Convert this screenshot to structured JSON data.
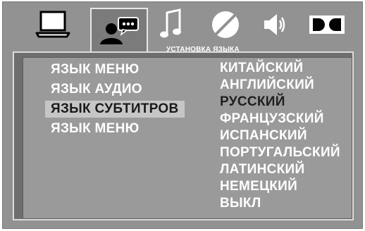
{
  "tabs": [
    {
      "icon": "monitor-icon"
    },
    {
      "icon": "user-chat-icon",
      "active": true
    },
    {
      "icon": "music-note-icon"
    },
    {
      "icon": "contrast-circle-icon"
    },
    {
      "icon": "speaker-icon"
    },
    {
      "icon": "dolby-icon"
    }
  ],
  "active_tab_caption": "УСТАНОВКА ЯЗЫКА",
  "menu_items": [
    {
      "label": "ЯЗЫК МЕНЮ"
    },
    {
      "label": "ЯЗЫК АУДИО"
    },
    {
      "label": "ЯЗЫК СУБТИТРОВ",
      "selected": true
    },
    {
      "label": "ЯЗЫК МЕНЮ"
    }
  ],
  "options": [
    {
      "label": "КИТАЙСКИЙ"
    },
    {
      "label": "АНГЛИЙСКИЙ"
    },
    {
      "label": "РУССКИЙ",
      "current": true
    },
    {
      "label": "ФРАНЦУЗСКИЙ"
    },
    {
      "label": "ИСПАНСКИЙ"
    },
    {
      "label": "ПОРТУГАЛЬСКИЙ"
    },
    {
      "label": "ЛАТИНСКИЙ"
    },
    {
      "label": "НЕМЕЦКИЙ"
    },
    {
      "label": "ВЫКЛ"
    }
  ],
  "colors": {
    "background": "#929292",
    "panel": "#9a9a9a",
    "highlight": "#c6c6c6",
    "text": "#ffffff"
  }
}
